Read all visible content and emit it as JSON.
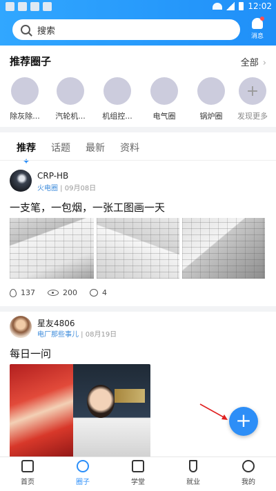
{
  "status_bar": {
    "time": "12:02"
  },
  "header": {
    "search_placeholder": "搜索",
    "messages_label": "消息"
  },
  "circles_section": {
    "title": "推荐圈子",
    "all_label": "全部",
    "items": [
      {
        "label": "除灰除..."
      },
      {
        "label": "汽轮机..."
      },
      {
        "label": "机组控..."
      },
      {
        "label": "电气圈"
      },
      {
        "label": "锅炉圈"
      },
      {
        "label": "发现更多"
      }
    ]
  },
  "tabs": [
    "推荐",
    "话题",
    "最新",
    "资料"
  ],
  "posts": [
    {
      "author": "CRP-HB",
      "circle": "火电圈",
      "date": "09月08日",
      "text": "一支笔，一包烟，一张工图画一天",
      "stats": {
        "likes": "137",
        "views": "200",
        "comments": "4"
      }
    },
    {
      "author": "星友4806",
      "circle": "电厂那些事儿",
      "date": "08月19日",
      "text": "每日一问"
    }
  ],
  "nav": [
    "首页",
    "圈子",
    "学堂",
    "就业",
    "我的"
  ],
  "colors": {
    "accent": "#2a8ef9",
    "header": "#31a7ff",
    "circle_link": "#3c8bdb"
  }
}
